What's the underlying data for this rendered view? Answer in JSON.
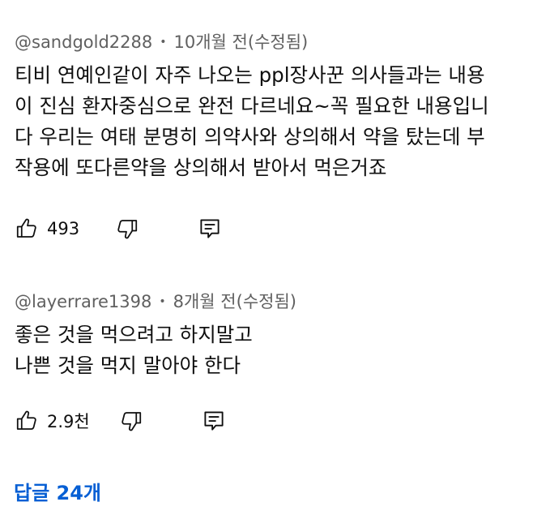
{
  "comments": [
    {
      "author": "@sandgold2288",
      "separator": "•",
      "time": "10개월 전(수정됨)",
      "lines": [
        "티비 연예인같이 자주 나오는 ppl장사꾼 의사들과는 내용",
        "이 진심 환자중심으로 완전 다르네요~꼭 필요한 내용입니",
        "다 우리는 여태 분명히 의약사와 상의해서 약을 탔는데 부",
        "작용에 또다른약을 상의해서 받아서 먹은거죠"
      ],
      "likes": "493"
    },
    {
      "author": "@layerrare1398",
      "separator": "•",
      "time": "8개월 전(수정됨)",
      "lines": [
        "좋은 것을 먹으려고 하지말고",
        "나쁜 것을 먹지 말아야 한다"
      ],
      "likes": "2.9천"
    }
  ],
  "icons": {
    "like": "thumb-up-icon",
    "dislike": "thumb-down-icon",
    "reply": "comment-reply-icon"
  },
  "replies_link": "답글 24개",
  "colors": {
    "text": "#0f0f0f",
    "meta": "#606060",
    "link": "#065fd4",
    "background": "#ffffff"
  }
}
